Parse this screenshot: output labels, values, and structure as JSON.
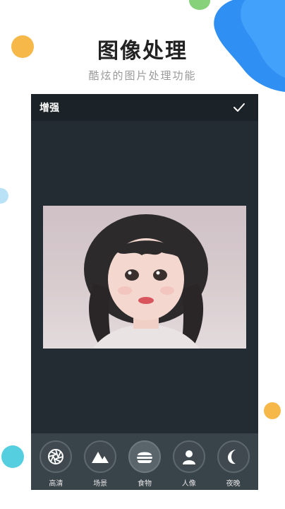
{
  "hero": {
    "title": "图像处理",
    "subtitle": "酷炫的图片处理功能"
  },
  "screen": {
    "toolbar": {
      "title": "增强",
      "confirm_icon": "check-icon"
    },
    "tools": [
      {
        "label": "高清",
        "icon": "aperture-icon"
      },
      {
        "label": "场景",
        "icon": "mountain-icon"
      },
      {
        "label": "食物",
        "icon": "burger-icon",
        "active": true
      },
      {
        "label": "人像",
        "icon": "person-icon"
      },
      {
        "label": "夜晚",
        "icon": "moon-icon"
      }
    ]
  },
  "colors": {
    "screen_bg": "#242c33",
    "toolbar_bg": "#1c2328",
    "toolbar_bottom_bg": "#39434a",
    "accent_blue": "#2f8ff2",
    "dot_orange": "#f7b84a",
    "dot_cyan": "#55cfe0"
  }
}
